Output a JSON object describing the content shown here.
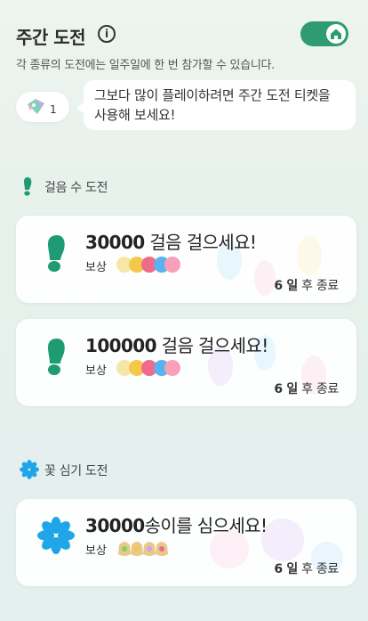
{
  "header": {
    "title": "주간 도전",
    "info_icon": "info-circle-icon",
    "toggle_icon": "home-icon",
    "toggle_color": "#2f9b74"
  },
  "subtitle": "각 종류의 도전에는 일주일에 한 번 참가할 수 있습니다.",
  "ticket": {
    "icon": "challenge-ticket-icon",
    "count": "1",
    "message": "그보다 많이 플레이하려면 주간 도전 티켓을 사용해 보세요!"
  },
  "sections": [
    {
      "title": "걸음 수 도전",
      "icon": "footprint-icon",
      "cards": [
        {
          "goal_number": "30000",
          "goal_text": " 걸음 걸으세요!",
          "reward_label": "보상",
          "reward_icon": "colored-orbs-icon",
          "end_number": "6 일",
          "end_text": " 후 종료"
        },
        {
          "goal_number": "100000",
          "goal_text": " 걸음 걸으세요!",
          "reward_label": "보상",
          "reward_icon": "colored-orbs-icon",
          "end_number": "6 일",
          "end_text": " 후 종료"
        }
      ]
    },
    {
      "title": "꽃 심기 도전",
      "icon": "flower-icon",
      "cards": [
        {
          "goal_number": "30000",
          "goal_text": "송이를 심으세요!",
          "reward_label": "보상",
          "reward_icon": "seed-bags-icon",
          "end_number": "6 일",
          "end_text": " 후 종료"
        }
      ]
    }
  ],
  "colors": {
    "accent_green": "#2f9b74",
    "footprint_green": "#1f9b74",
    "flower_blue": "#1ea6e8"
  }
}
